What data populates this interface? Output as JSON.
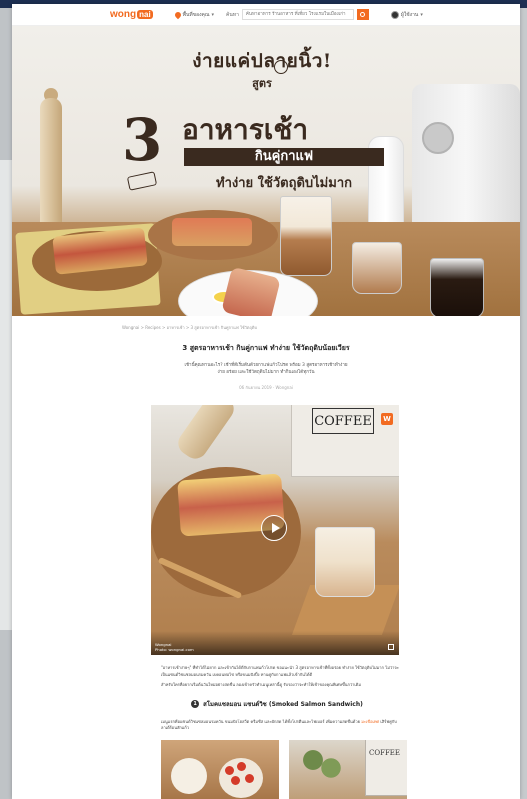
{
  "header": {
    "logo_text": "wong",
    "logo_badge": "nai",
    "location": "พื้นที่ของคุณ",
    "search_label": "ค้นหา",
    "search_placeholder": "ค้นหาอาหาร ร้านอาหาร ที่เที่ยว โรงแรมในเมืองเก่า",
    "user_name": "ผู้ใช้งาน"
  },
  "hero": {
    "line1": "ง่ายแค่ปลายนิ้ว!",
    "line2": "สูตร",
    "big_number": "3",
    "line3": "อาหารเช้า",
    "line4": "กินคู่กาแฟ",
    "line5": "ทำง่าย ใช้วัตถุดิบไม่มาก"
  },
  "article": {
    "breadcrumb": "Wongnai > Recipes > อาหารเช้า > 3 สูตรอาหารเช้า กินคู่กาแฟ ใช้วัตถุดิบ",
    "title": "3 สูตรอาหารเช้า กินคู่กาแฟ ทำง่าย ใช้วัตถุดิบน้อยเวียร",
    "subtitle_line1": "เช้านี้คุณทานอะไร? เช้าที่ดีเริ่มต้นด้วยกาแฟแก้วโปรด พร้อม 3 สูตรอาหารเช้าทำง่าย",
    "subtitle_line2": "ง่าย อร่อย และใช้วัตถุดิบไม่มาก ทำกินเองได้ทุกวัน",
    "date": "06 กันยายน 2019 · Wongnai"
  },
  "video": {
    "tin_label": "COFFEE",
    "badge": "W",
    "credit_line1": "Wongnai",
    "credit_line2": "Photo: wongnai.com"
  },
  "body": {
    "para1": "\"อาหารเช้าง่ายๆ\" ที่ทำได้ไม่ยาก และเข้ากันได้ดีกับกาแฟแก้วโปรด ขอแนะนำ 3 สูตรอาหารเช้าที่ทั้งอร่อย ทำง่าย ใช้วัตถุดิบไม่มาก ไม่ว่าจะเป็นแซนด์วิชแซลมอนรมควัน เบคอนห่อไข่ หรือขนมปังปิ้ง ทานคู่กับกาแฟแล้วเข้ากันได้ดี",
    "para2": "สำหรับใครที่อยากเริ่มต้นวันใหม่อย่างสดชื่น ลองเข้าครัวทำเมนูเหล่านี้ดู รับรองว่าจะทำให้เช้าของคุณพิเศษขึ้นกว่าเดิม",
    "section_number": "1",
    "section_title": "สโมคแซลมอน แซนด์วิช (Smoked Salmon Sandwich)",
    "para3_before": "เมนูแรกคือแซนด์วิชแซลมอนรมควัน ขนมปังโฮลวีต ครีมชีส และผักสด ได้ทั้งโปรตีนและไฟเบอร์ เพิ่มความสดชื่นด้วย",
    "para3_highlight": "มะเขือเทศ",
    "para3_after": "เสิร์ฟคู่กับลาเต้ร้อนสักแก้ว"
  },
  "thumbs": {
    "tin_text": "COFFEE"
  }
}
